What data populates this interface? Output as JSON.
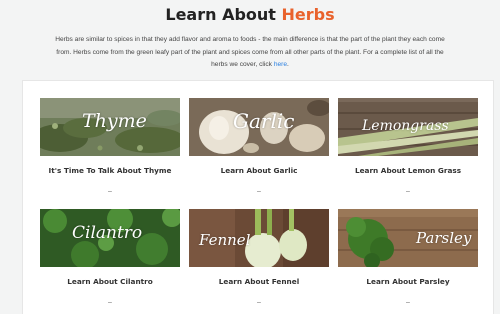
{
  "page": {
    "title_prefix": "Learn About",
    "title_accent": "Herbs",
    "intro_text": "Herbs are similar to spices in that they add flavor and aroma to foods - the main difference is that the part of the plant they each come from. Herbs come from the green leafy part of the plant and spices come from all other parts of the plant. For a complete list of all the herbs we cover, click",
    "intro_link": "here",
    "intro_end": "."
  },
  "cards": [
    {
      "image_label": "Thyme",
      "title": "It's Time To Talk About Thyme",
      "dash": "–"
    },
    {
      "image_label": "Garlic",
      "title": "Learn About Garlic",
      "dash": "–"
    },
    {
      "image_label": "Lemongrass",
      "title": "Learn About Lemon Grass",
      "dash": "–"
    },
    {
      "image_label": "Cilantro",
      "title": "Learn About Cilantro",
      "dash": "–"
    },
    {
      "image_label": "Fennel",
      "title": "Learn About Fennel",
      "dash": "–"
    },
    {
      "image_label": "Parsley",
      "title": "Learn About Parsley",
      "dash": "–"
    }
  ],
  "colors": {
    "accent": "#e9622c",
    "link": "#2a7fe0",
    "background": "#f3f4f4"
  }
}
